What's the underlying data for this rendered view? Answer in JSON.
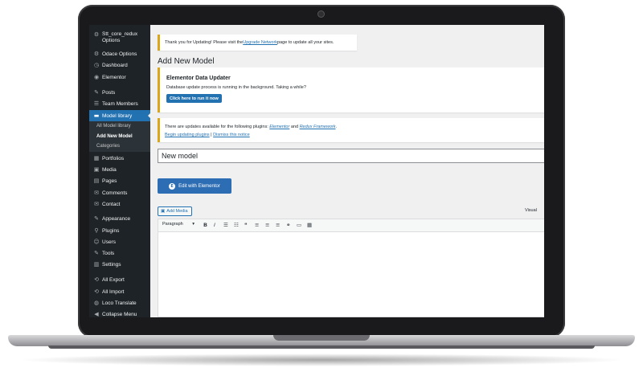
{
  "sidebar": {
    "items": [
      {
        "icon": "gear-icon",
        "glyph": "⚙",
        "label_line1": "Stt_core_redux",
        "label_line2": "Options"
      },
      {
        "icon": "gear-icon",
        "glyph": "⚙",
        "label": "Odace Options"
      },
      {
        "icon": "dashboard-icon",
        "glyph": "◷",
        "label": "Dashboard"
      },
      {
        "icon": "elementor-icon",
        "glyph": "◉",
        "label": "Elementor"
      },
      {
        "icon": "pin-icon",
        "glyph": "✎",
        "label": "Posts"
      },
      {
        "icon": "team-icon",
        "glyph": "☰",
        "label": "Team Members"
      },
      {
        "icon": "folder-icon",
        "glyph": "▬",
        "label": "Model library"
      },
      {
        "icon": "portfolio-icon",
        "glyph": "▦",
        "label": "Portfolios"
      },
      {
        "icon": "media-icon",
        "glyph": "▣",
        "label": "Media"
      },
      {
        "icon": "pages-icon",
        "glyph": "▤",
        "label": "Pages"
      },
      {
        "icon": "comments-icon",
        "glyph": "✉",
        "label": "Comments"
      },
      {
        "icon": "contact-icon",
        "glyph": "✉",
        "label": "Contact"
      },
      {
        "icon": "appearance-icon",
        "glyph": "✎",
        "label": "Appearance"
      },
      {
        "icon": "plugins-icon",
        "glyph": "⚲",
        "label": "Plugins"
      },
      {
        "icon": "users-icon",
        "glyph": "☺",
        "label": "Users"
      },
      {
        "icon": "tools-icon",
        "glyph": "✎",
        "label": "Tools"
      },
      {
        "icon": "settings-icon",
        "glyph": "▥",
        "label": "Settings"
      },
      {
        "icon": "export-icon",
        "glyph": "⟲",
        "label": "All Export"
      },
      {
        "icon": "import-icon",
        "glyph": "⟲",
        "label": "All Import"
      },
      {
        "icon": "translate-icon",
        "glyph": "◍",
        "label": "Loco Translate"
      },
      {
        "icon": "collapse-icon",
        "glyph": "◀",
        "label": "Collapse Menu"
      }
    ],
    "submenu": [
      "All Model library",
      "Add New Model",
      "Categories"
    ]
  },
  "notices": {
    "update": {
      "before": "Thank you for Updating! Please visit the ",
      "link": "Upgrade Network",
      "after": " page to update all your sites."
    },
    "elementor": {
      "title": "Elementor Data Updater",
      "text": "Database update process is running in the background. Taking a while?",
      "button": "Click here to run it now"
    },
    "plugins": {
      "before": "There are updates available for the following plugins: ",
      "plugin1": "Elementor",
      "and": " and ",
      "plugin2": "Redux Framework",
      "end": ".",
      "begin_link": "Begin updating plugins",
      "sep": " | ",
      "dismiss_link": "Dismiss this notice"
    }
  },
  "page": {
    "title": "Add New Model"
  },
  "editor": {
    "title_value": "New model",
    "elementor_button": "Edit with Elementor",
    "elementor_logo": "E",
    "add_media": "Add Media",
    "add_media_glyph": "▣",
    "visual_tab": "Visual",
    "format_select": "Paragraph",
    "format_arrow": "▾",
    "toolbar": [
      {
        "name": "bold-icon",
        "glyph": "B"
      },
      {
        "name": "italic-icon",
        "glyph": "I"
      },
      {
        "name": "bullet-list-icon",
        "glyph": "☰"
      },
      {
        "name": "numbered-list-icon",
        "glyph": "☷"
      },
      {
        "name": "blockquote-icon",
        "glyph": "❝"
      },
      {
        "name": "align-left-icon",
        "glyph": "≡"
      },
      {
        "name": "align-center-icon",
        "glyph": "≡"
      },
      {
        "name": "align-right-icon",
        "glyph": "≡"
      },
      {
        "name": "link-icon",
        "glyph": "⚭"
      },
      {
        "name": "read-more-icon",
        "glyph": "▭"
      },
      {
        "name": "toolbar-toggle-icon",
        "glyph": "▦"
      }
    ]
  }
}
